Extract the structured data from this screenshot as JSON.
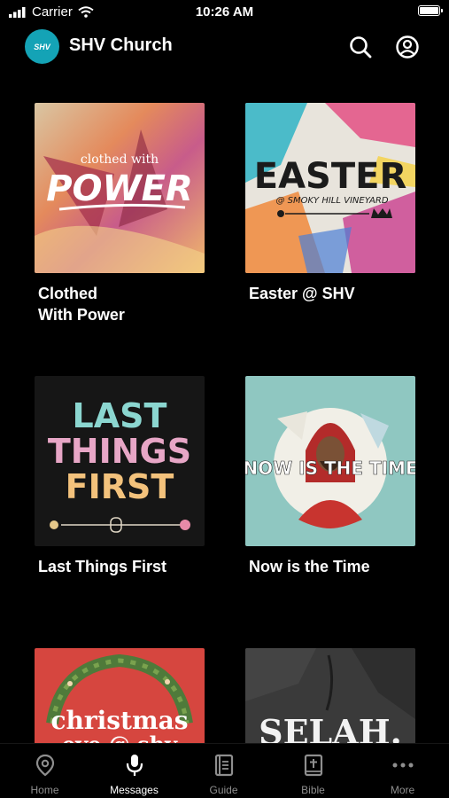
{
  "status_bar": {
    "carrier": "Carrier",
    "time": "10:26 AM"
  },
  "header": {
    "logo_text": "SHV",
    "title": "SHV Church"
  },
  "series": [
    {
      "title": "Clothed\nWith Power",
      "art_line1": "clothed with",
      "art_line2": "POWER"
    },
    {
      "title": "Easter @ SHV",
      "art_line1": "EASTER",
      "art_line2": "@ SMOKY HILL VINEYARD"
    },
    {
      "title": "Last Things First",
      "art_line1": "LAST",
      "art_line2": "THINGS",
      "art_line3": "FIRST"
    },
    {
      "title": "Now is the Time",
      "art_line1": "NOW IS THE TIME"
    },
    {
      "title": "",
      "art_line1": "christmas",
      "art_line2": "eve @ shv"
    },
    {
      "title": "",
      "art_line1": "SELAH."
    }
  ],
  "tabs": [
    {
      "label": "Home",
      "icon": "location-pin-icon",
      "active": false
    },
    {
      "label": "Messages",
      "icon": "microphone-icon",
      "active": true
    },
    {
      "label": "Guide",
      "icon": "book-icon",
      "active": false
    },
    {
      "label": "Bible",
      "icon": "bible-icon",
      "active": false
    },
    {
      "label": "More",
      "icon": "more-dots-icon",
      "active": false
    }
  ],
  "colors": {
    "accent": "#14a3b6",
    "background": "#000000",
    "inactive_tab": "#8e8e8e"
  }
}
